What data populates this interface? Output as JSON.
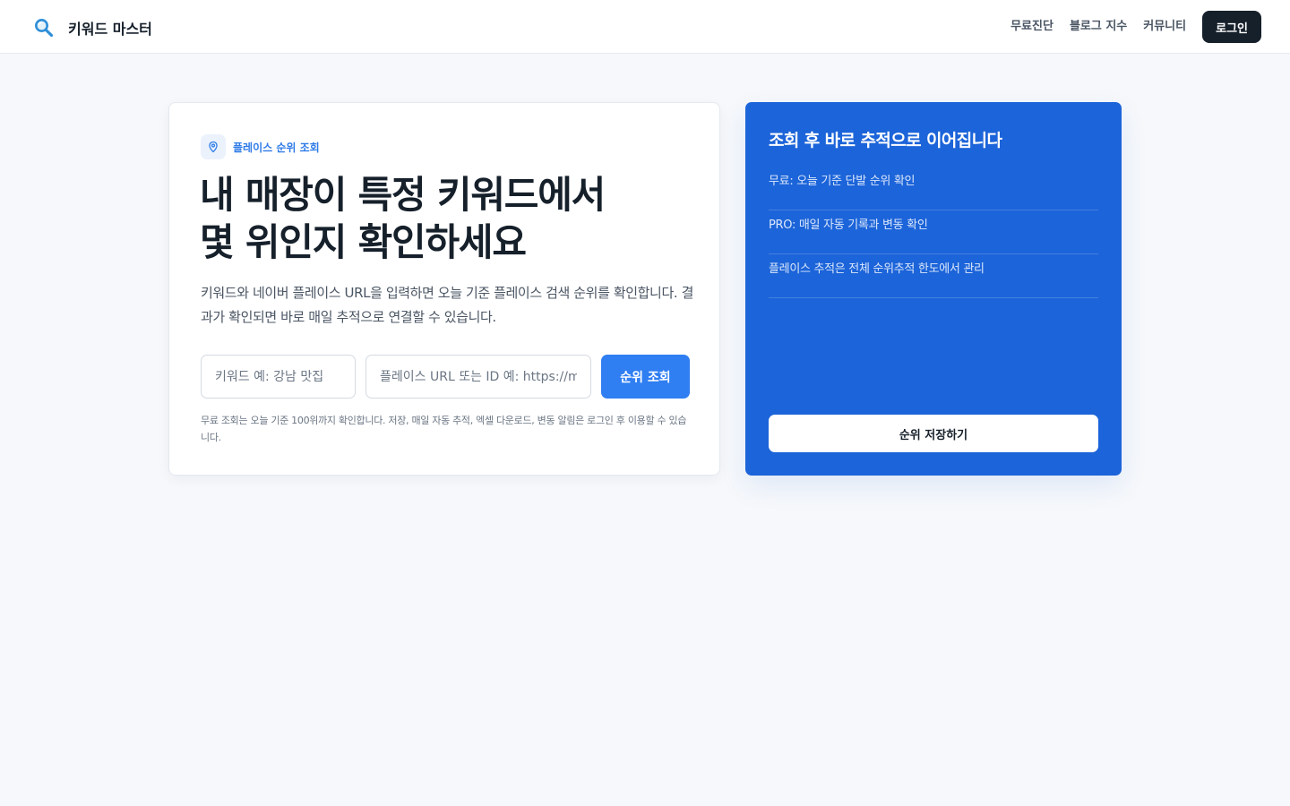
{
  "header": {
    "brand": "키워드 마스터",
    "logo_icon": "magnifier-icon",
    "nav": [
      "무료진단",
      "블로그 지수",
      "커뮤니티"
    ],
    "login_label": "로그인"
  },
  "card": {
    "badge_icon": "map-pin-icon",
    "badge_label": "플레이스 순위 조회",
    "title_line1": "내 매장이 특정 키워드에서",
    "title_line2": "몇 위인지 확인하세요",
    "description": "키워드와 네이버 플레이스 URL을 입력하면 오늘 기준 플레이스 검색 순위를 확인합니다. 결과가 확인되면 바로 매일 추적으로 연결할 수 있습니다.",
    "keyword_placeholder": "키워드 예: 강남 맛집",
    "url_placeholder": "플레이스 URL 또는 ID 예: https://m.place.naver.com/...",
    "search_button": "순위 조회",
    "hint": "무료 조회는 오늘 기준 100위까지 확인합니다. 저장, 매일 자동 추적, 엑셀 다운로드, 변동 알림은 로그인 후 이용할 수 있습니다."
  },
  "panel": {
    "title": "조회 후 바로 추적으로 이어집니다",
    "items": [
      "무료: 오늘 기준 단발 순위 확인",
      "PRO: 매일 자동 기록과 변동 확인",
      "플레이스 추적은 전체 순위추적 한도에서 관리"
    ],
    "save_button": "순위 저장하기"
  },
  "colors": {
    "primary": "#2f7ef2",
    "panel_bg": "#1c64d9",
    "dark": "#16202b",
    "page_bg": "#f6f8fb"
  }
}
